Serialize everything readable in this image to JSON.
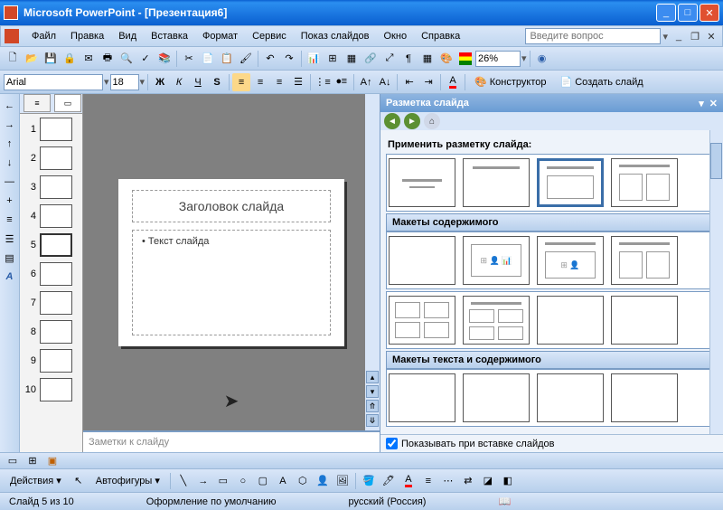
{
  "titlebar": {
    "title": "Microsoft PowerPoint - [Презентация6]"
  },
  "menu": {
    "file": "Файл",
    "edit": "Правка",
    "view": "Вид",
    "insert": "Вставка",
    "format": "Формат",
    "service": "Сервис",
    "slideshow": "Показ слайдов",
    "window": "Окно",
    "help": "Справка",
    "help_placeholder": "Введите вопрос"
  },
  "toolbar": {
    "zoom": "26%"
  },
  "format_bar": {
    "font": "Arial",
    "size": "18",
    "designer": "Конструктор",
    "new_slide": "Создать слайд"
  },
  "thumbs": [
    1,
    2,
    3,
    4,
    5,
    6,
    7,
    8,
    9,
    10
  ],
  "thumbs_selected": 5,
  "slide": {
    "title": "Заголовок слайда",
    "body": "Текст слайда"
  },
  "notes_placeholder": "Заметки к слайду",
  "task_pane": {
    "title": "Разметка слайда",
    "apply_label": "Применить разметку слайда:",
    "content_label": "Макеты содержимого",
    "textcontent_label": "Макеты текста и содержимого",
    "show_on_insert": "Показывать при вставке слайдов"
  },
  "draw_bar": {
    "actions": "Действия",
    "autoshapes": "Автофигуры"
  },
  "status": {
    "slide": "Слайд 5 из 10",
    "design": "Оформление по умолчанию",
    "lang": "русский (Россия)"
  }
}
